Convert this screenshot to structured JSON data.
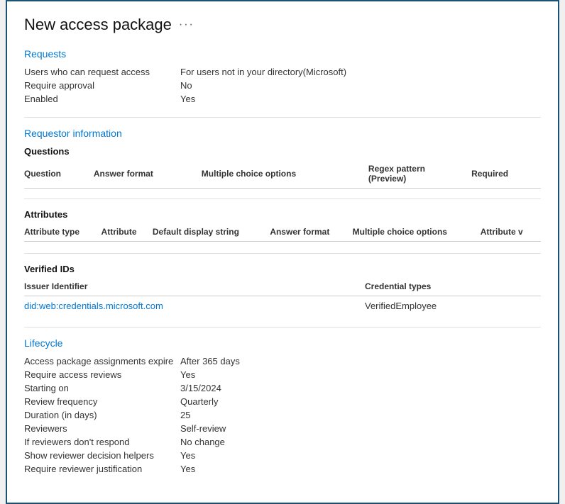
{
  "header": {
    "title": "New access package",
    "more_icon": "···"
  },
  "requests_section": {
    "title": "Requests",
    "fields": [
      {
        "label": "Users who can request access",
        "value": "For users not in your directory(Microsoft)"
      },
      {
        "label": "Require approval",
        "value": "No"
      },
      {
        "label": "Enabled",
        "value": "Yes"
      }
    ]
  },
  "requestor_section": {
    "title": "Requestor information",
    "questions": {
      "title": "Questions",
      "columns": [
        "Question",
        "Answer format",
        "Multiple choice options",
        "Regex pattern (Preview)",
        "Required"
      ]
    },
    "attributes": {
      "title": "Attributes",
      "columns": [
        "Attribute type",
        "Attribute",
        "Default display string",
        "Answer format",
        "Multiple choice options",
        "Attribute v"
      ]
    }
  },
  "verified_ids": {
    "title": "Verified IDs",
    "columns": [
      "Issuer Identifier",
      "Credential types"
    ],
    "rows": [
      {
        "issuer": "did:web:credentials.microsoft.com",
        "credential": "VerifiedEmployee"
      }
    ]
  },
  "lifecycle_section": {
    "title": "Lifecycle",
    "fields": [
      {
        "label": "Access package assignments expire",
        "value": "After 365 days"
      },
      {
        "label": "Require access reviews",
        "value": "Yes"
      },
      {
        "label": "Starting on",
        "value": "3/15/2024"
      },
      {
        "label": "Review frequency",
        "value": "Quarterly"
      },
      {
        "label": "Duration (in days)",
        "value": "25"
      },
      {
        "label": "Reviewers",
        "value": "Self-review"
      },
      {
        "label": "If reviewers don't respond",
        "value": "No change"
      },
      {
        "label": "Show reviewer decision helpers",
        "value": "Yes"
      },
      {
        "label": "Require reviewer justification",
        "value": "Yes"
      }
    ]
  }
}
